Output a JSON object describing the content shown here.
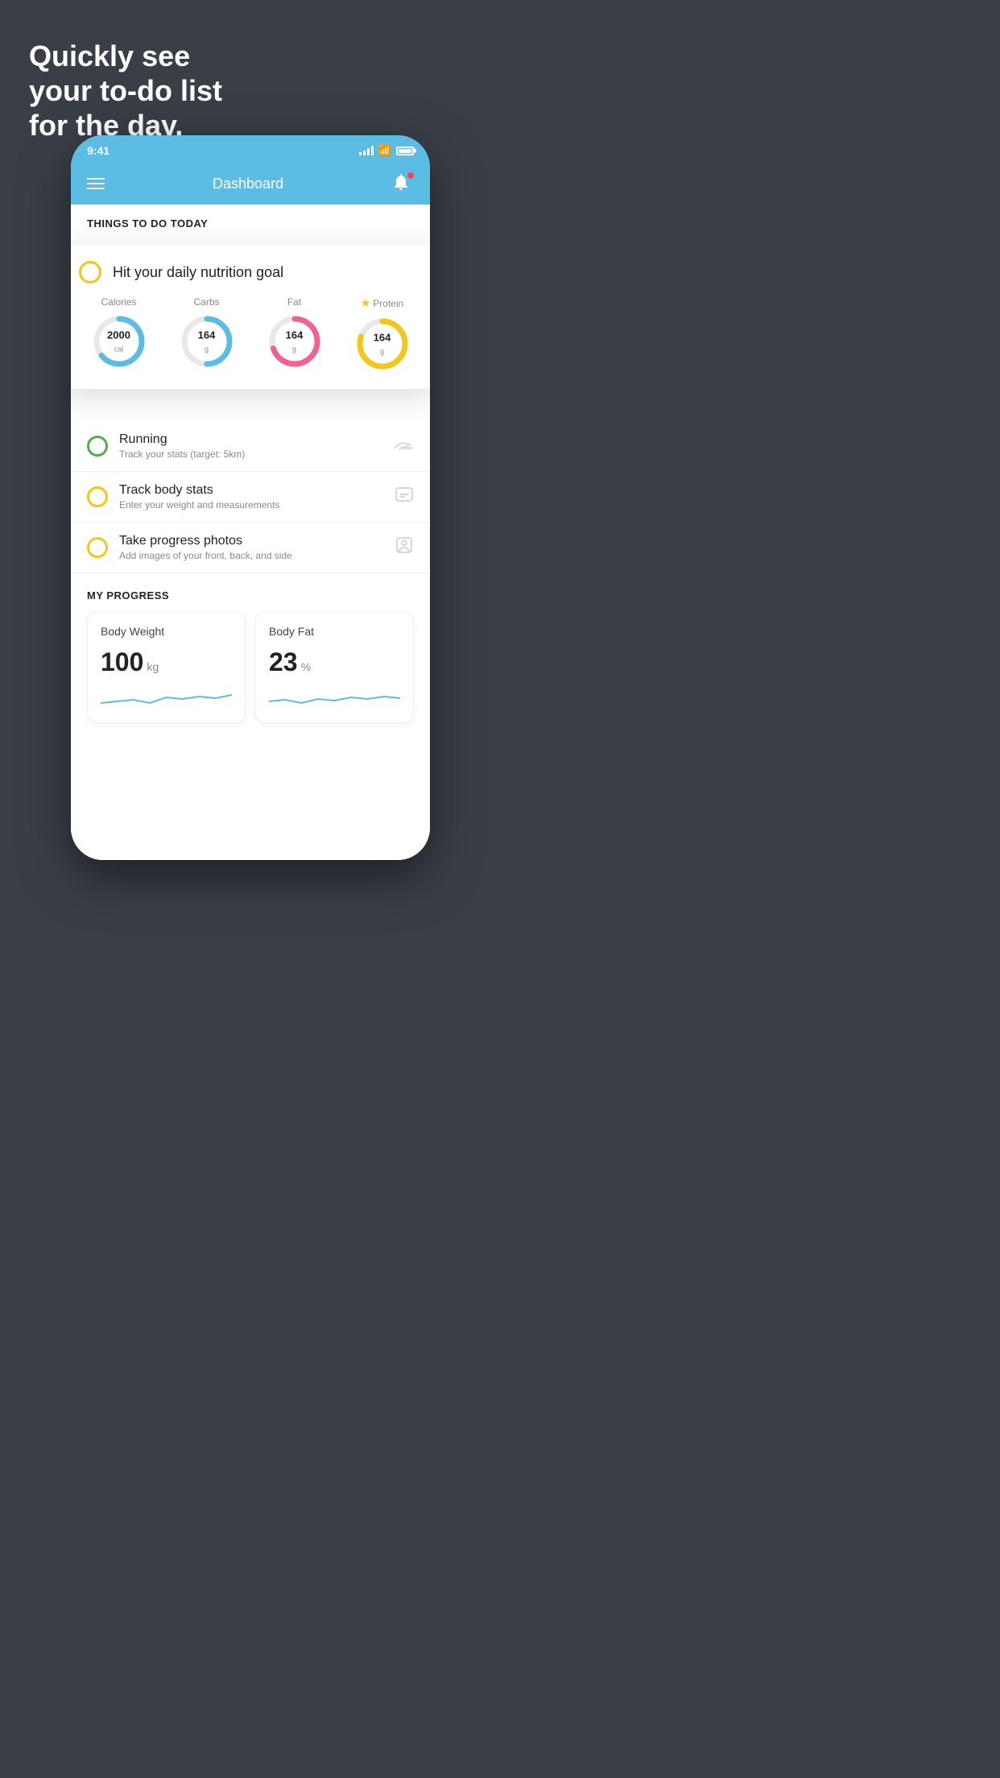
{
  "headline": {
    "line1": "Quickly see",
    "line2": "your to-do list",
    "line3": "for the day."
  },
  "status_bar": {
    "time": "9:41"
  },
  "nav": {
    "title": "Dashboard"
  },
  "things_header": "THINGS TO DO TODAY",
  "nutrition_card": {
    "title": "Hit your daily nutrition goal",
    "stats": [
      {
        "label": "Calories",
        "value": "2000",
        "unit": "cal",
        "color": "#5bbde4",
        "percent": 65
      },
      {
        "label": "Carbs",
        "value": "164",
        "unit": "g",
        "color": "#5bbde4",
        "percent": 50
      },
      {
        "label": "Fat",
        "value": "164",
        "unit": "g",
        "color": "#f06292",
        "percent": 70
      },
      {
        "label": "Protein",
        "value": "164",
        "unit": "g",
        "color": "#f5c518",
        "percent": 80,
        "star": true
      }
    ]
  },
  "todo_items": [
    {
      "title": "Running",
      "subtitle": "Track your stats (target: 5km)",
      "type": "green",
      "icon": "shoe"
    },
    {
      "title": "Track body stats",
      "subtitle": "Enter your weight and measurements",
      "type": "yellow",
      "icon": "scale"
    },
    {
      "title": "Take progress photos",
      "subtitle": "Add images of your front, back, and side",
      "type": "yellow",
      "icon": "person"
    }
  ],
  "progress": {
    "header": "MY PROGRESS",
    "cards": [
      {
        "title": "Body Weight",
        "value": "100",
        "unit": "kg"
      },
      {
        "title": "Body Fat",
        "value": "23",
        "unit": "%"
      }
    ]
  }
}
